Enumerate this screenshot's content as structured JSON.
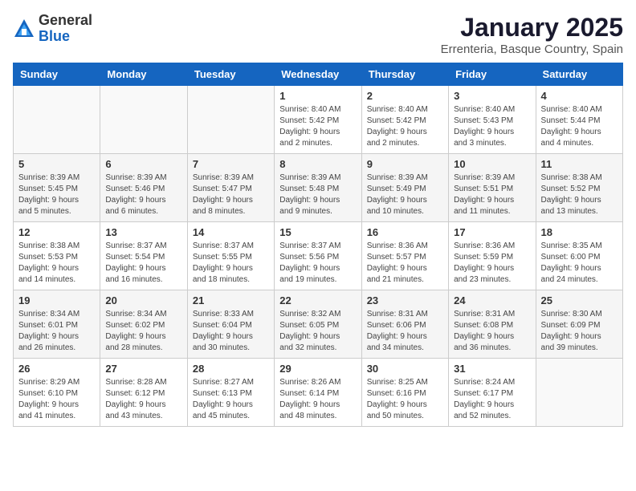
{
  "logo": {
    "general": "General",
    "blue": "Blue"
  },
  "title": "January 2025",
  "subtitle": "Errenteria, Basque Country, Spain",
  "weekdays": [
    "Sunday",
    "Monday",
    "Tuesday",
    "Wednesday",
    "Thursday",
    "Friday",
    "Saturday"
  ],
  "weeks": [
    [
      {
        "day": "",
        "info": ""
      },
      {
        "day": "",
        "info": ""
      },
      {
        "day": "",
        "info": ""
      },
      {
        "day": "1",
        "info": "Sunrise: 8:40 AM\nSunset: 5:42 PM\nDaylight: 9 hours\nand 2 minutes."
      },
      {
        "day": "2",
        "info": "Sunrise: 8:40 AM\nSunset: 5:42 PM\nDaylight: 9 hours\nand 2 minutes."
      },
      {
        "day": "3",
        "info": "Sunrise: 8:40 AM\nSunset: 5:43 PM\nDaylight: 9 hours\nand 3 minutes."
      },
      {
        "day": "4",
        "info": "Sunrise: 8:40 AM\nSunset: 5:44 PM\nDaylight: 9 hours\nand 4 minutes."
      }
    ],
    [
      {
        "day": "5",
        "info": "Sunrise: 8:39 AM\nSunset: 5:45 PM\nDaylight: 9 hours\nand 5 minutes."
      },
      {
        "day": "6",
        "info": "Sunrise: 8:39 AM\nSunset: 5:46 PM\nDaylight: 9 hours\nand 6 minutes."
      },
      {
        "day": "7",
        "info": "Sunrise: 8:39 AM\nSunset: 5:47 PM\nDaylight: 9 hours\nand 8 minutes."
      },
      {
        "day": "8",
        "info": "Sunrise: 8:39 AM\nSunset: 5:48 PM\nDaylight: 9 hours\nand 9 minutes."
      },
      {
        "day": "9",
        "info": "Sunrise: 8:39 AM\nSunset: 5:49 PM\nDaylight: 9 hours\nand 10 minutes."
      },
      {
        "day": "10",
        "info": "Sunrise: 8:39 AM\nSunset: 5:51 PM\nDaylight: 9 hours\nand 11 minutes."
      },
      {
        "day": "11",
        "info": "Sunrise: 8:38 AM\nSunset: 5:52 PM\nDaylight: 9 hours\nand 13 minutes."
      }
    ],
    [
      {
        "day": "12",
        "info": "Sunrise: 8:38 AM\nSunset: 5:53 PM\nDaylight: 9 hours\nand 14 minutes."
      },
      {
        "day": "13",
        "info": "Sunrise: 8:37 AM\nSunset: 5:54 PM\nDaylight: 9 hours\nand 16 minutes."
      },
      {
        "day": "14",
        "info": "Sunrise: 8:37 AM\nSunset: 5:55 PM\nDaylight: 9 hours\nand 18 minutes."
      },
      {
        "day": "15",
        "info": "Sunrise: 8:37 AM\nSunset: 5:56 PM\nDaylight: 9 hours\nand 19 minutes."
      },
      {
        "day": "16",
        "info": "Sunrise: 8:36 AM\nSunset: 5:57 PM\nDaylight: 9 hours\nand 21 minutes."
      },
      {
        "day": "17",
        "info": "Sunrise: 8:36 AM\nSunset: 5:59 PM\nDaylight: 9 hours\nand 23 minutes."
      },
      {
        "day": "18",
        "info": "Sunrise: 8:35 AM\nSunset: 6:00 PM\nDaylight: 9 hours\nand 24 minutes."
      }
    ],
    [
      {
        "day": "19",
        "info": "Sunrise: 8:34 AM\nSunset: 6:01 PM\nDaylight: 9 hours\nand 26 minutes."
      },
      {
        "day": "20",
        "info": "Sunrise: 8:34 AM\nSunset: 6:02 PM\nDaylight: 9 hours\nand 28 minutes."
      },
      {
        "day": "21",
        "info": "Sunrise: 8:33 AM\nSunset: 6:04 PM\nDaylight: 9 hours\nand 30 minutes."
      },
      {
        "day": "22",
        "info": "Sunrise: 8:32 AM\nSunset: 6:05 PM\nDaylight: 9 hours\nand 32 minutes."
      },
      {
        "day": "23",
        "info": "Sunrise: 8:31 AM\nSunset: 6:06 PM\nDaylight: 9 hours\nand 34 minutes."
      },
      {
        "day": "24",
        "info": "Sunrise: 8:31 AM\nSunset: 6:08 PM\nDaylight: 9 hours\nand 36 minutes."
      },
      {
        "day": "25",
        "info": "Sunrise: 8:30 AM\nSunset: 6:09 PM\nDaylight: 9 hours\nand 39 minutes."
      }
    ],
    [
      {
        "day": "26",
        "info": "Sunrise: 8:29 AM\nSunset: 6:10 PM\nDaylight: 9 hours\nand 41 minutes."
      },
      {
        "day": "27",
        "info": "Sunrise: 8:28 AM\nSunset: 6:12 PM\nDaylight: 9 hours\nand 43 minutes."
      },
      {
        "day": "28",
        "info": "Sunrise: 8:27 AM\nSunset: 6:13 PM\nDaylight: 9 hours\nand 45 minutes."
      },
      {
        "day": "29",
        "info": "Sunrise: 8:26 AM\nSunset: 6:14 PM\nDaylight: 9 hours\nand 48 minutes."
      },
      {
        "day": "30",
        "info": "Sunrise: 8:25 AM\nSunset: 6:16 PM\nDaylight: 9 hours\nand 50 minutes."
      },
      {
        "day": "31",
        "info": "Sunrise: 8:24 AM\nSunset: 6:17 PM\nDaylight: 9 hours\nand 52 minutes."
      },
      {
        "day": "",
        "info": ""
      }
    ]
  ]
}
